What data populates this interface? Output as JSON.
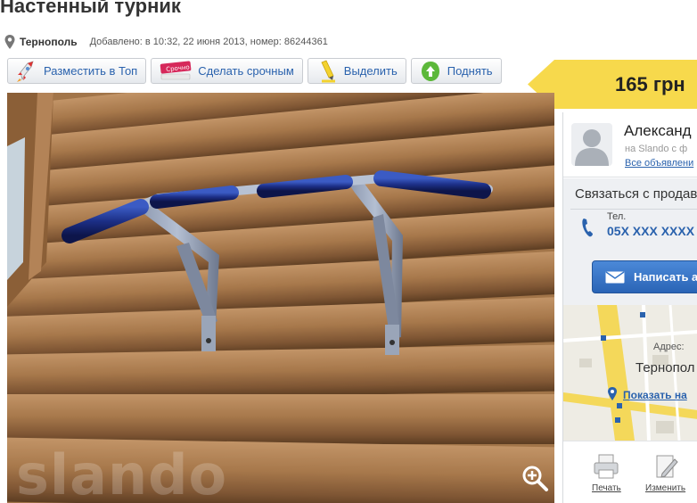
{
  "ad": {
    "title": "Настенный турник",
    "city": "Тернополь",
    "added": "Добавлено: в 10:32, 22 июня 2013, номер: 86244361"
  },
  "actions": [
    {
      "label": "Разместить в Топ",
      "icon": "rocket-icon"
    },
    {
      "label": "Сделать срочным",
      "icon": "urgent-stamp-icon"
    },
    {
      "label": "Выделить",
      "icon": "highlighter-icon"
    },
    {
      "label": "Поднять",
      "icon": "up-arrow-leaf-icon"
    }
  ],
  "price": {
    "value": "165 грн"
  },
  "photo": {
    "watermark": "slando",
    "zoom_icon": "zoom-in-icon"
  },
  "seller": {
    "name": "Александ",
    "since": "на Slando с ф",
    "all_ads": "Все объявлени"
  },
  "contact": {
    "header": "Связаться с продав",
    "phone_label": "Тел.",
    "phone": "05X XXX XXXX",
    "write_button": "Написать а"
  },
  "map": {
    "address_label": "Адрес:",
    "address": "Тернопол",
    "show_link": "Показать на"
  },
  "tools": [
    {
      "label": "Печать",
      "icon": "printer-icon"
    },
    {
      "label": "Изменить",
      "icon": "edit-icon"
    }
  ],
  "colors": {
    "link": "#2a62ad",
    "price_tag": "#f7d94c",
    "write_button": "#3474c6",
    "wood": "#a0734a"
  }
}
